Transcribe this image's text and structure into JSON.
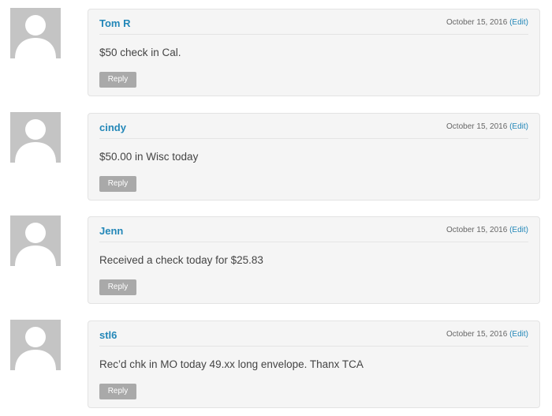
{
  "comments": [
    {
      "author": "Tom R",
      "date": "October 15, 2016",
      "edit_label": "(Edit)",
      "text": "$50 check in Cal.",
      "reply_label": "Reply",
      "avatar_icon": "default-avatar-icon"
    },
    {
      "author": "cindy",
      "date": "October 15, 2016",
      "edit_label": "(Edit)",
      "text": "$50.00 in Wisc today",
      "reply_label": "Reply",
      "avatar_icon": "default-avatar-icon"
    },
    {
      "author": "Jenn",
      "date": "October 15, 2016",
      "edit_label": "(Edit)",
      "text": "Received a check today for $25.83",
      "reply_label": "Reply",
      "avatar_icon": "default-avatar-icon"
    },
    {
      "author": "stl6",
      "date": "October 15, 2016",
      "edit_label": "(Edit)",
      "text": "Rec’d chk in MO today 49.xx long envelope. Thanx TCA",
      "reply_label": "Reply",
      "avatar_icon": "default-avatar-icon"
    }
  ],
  "colors": {
    "author": "#2387b8",
    "avatar_bg": "#c4c4c4",
    "card_bg": "#f5f5f5",
    "reply_bg": "#a9a9a9"
  }
}
